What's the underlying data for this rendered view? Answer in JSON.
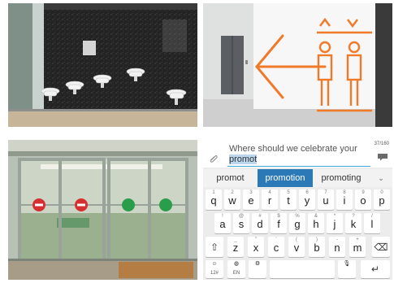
{
  "panels": {
    "washbasins": {
      "icon": "wall-sinks-photo"
    },
    "elevator_sign": {
      "icon": "elevator-arrow-sign-photo"
    },
    "doors": {
      "icon": "sliding-doors-photo",
      "colors": {
        "no_entry": "#d62f2f",
        "green": "#2a9d4b"
      }
    },
    "keyboard": {
      "compose_prefix": "Where should we celebrate your ",
      "compose_highlight": "promot",
      "counter": "37/160",
      "suggestions": [
        "promot",
        "promotion",
        "promoting"
      ],
      "suggestion_more": "⌄",
      "rows": {
        "row1": [
          {
            "k": "q",
            "a": "1"
          },
          {
            "k": "w",
            "a": "2"
          },
          {
            "k": "e",
            "a": "3"
          },
          {
            "k": "r",
            "a": "4"
          },
          {
            "k": "t",
            "a": "5"
          },
          {
            "k": "y",
            "a": "6"
          },
          {
            "k": "u",
            "a": "7"
          },
          {
            "k": "i",
            "a": "8"
          },
          {
            "k": "o",
            "a": "9"
          },
          {
            "k": "p",
            "a": "0"
          }
        ],
        "row2": [
          {
            "k": "a",
            "a": "!"
          },
          {
            "k": "s",
            "a": "@"
          },
          {
            "k": "d",
            "a": "#"
          },
          {
            "k": "f",
            "a": "$"
          },
          {
            "k": "g",
            "a": "%"
          },
          {
            "k": "h",
            "a": "&"
          },
          {
            "k": "j",
            "a": "*"
          },
          {
            "k": "k",
            "a": "?"
          },
          {
            "k": "l",
            "a": "/"
          }
        ],
        "row3": [
          {
            "k": "z",
            "a": "_"
          },
          {
            "k": "x",
            "a": "\""
          },
          {
            "k": "c",
            "a": "'"
          },
          {
            "k": "v",
            "a": "("
          },
          {
            "k": "b",
            "a": ")"
          },
          {
            "k": "n",
            "a": "-"
          },
          {
            "k": "m",
            "a": "+"
          }
        ]
      },
      "keys": {
        "shift": "⇧",
        "backspace": "⌫",
        "emoji_label": "12#",
        "lang_label": "EN",
        "enter": "↵"
      },
      "colors": {
        "accent": "#2c79b7",
        "highlight": "#bcd6ee",
        "underline": "#3fa9d6"
      }
    }
  }
}
